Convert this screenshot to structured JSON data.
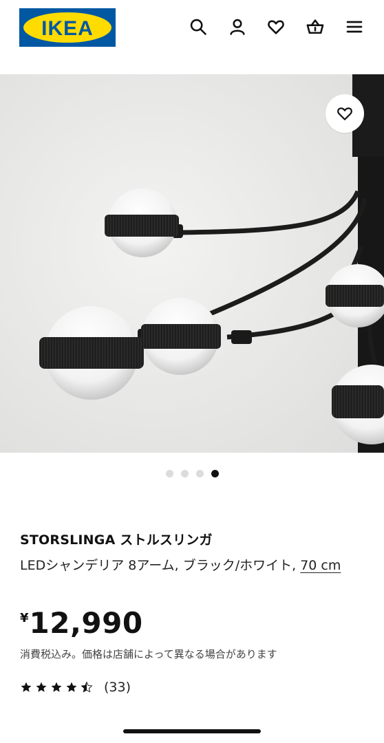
{
  "brand": {
    "logo_text": "IKEA",
    "blue": "#0058A3",
    "yellow": "#FFDB00"
  },
  "header": {
    "icons": [
      "search-icon",
      "account-icon",
      "heart-icon",
      "cart-icon",
      "menu-icon"
    ]
  },
  "gallery": {
    "image_subject": "chandelier",
    "dots_total": 4,
    "active_dot": 4,
    "favorite_icon": "heart-icon"
  },
  "product": {
    "name": "STORSLINGA ストルスリンガ",
    "description": "LEDシャンデリア 8アーム, ブラック/ホワイト, ",
    "size": "70 cm",
    "currency": "¥",
    "price": "12,990",
    "tax_note": "消費税込み。価格は店舗によって異なる場合があります",
    "rating": 4.5,
    "rating_max": 5,
    "review_count": "(33)"
  }
}
